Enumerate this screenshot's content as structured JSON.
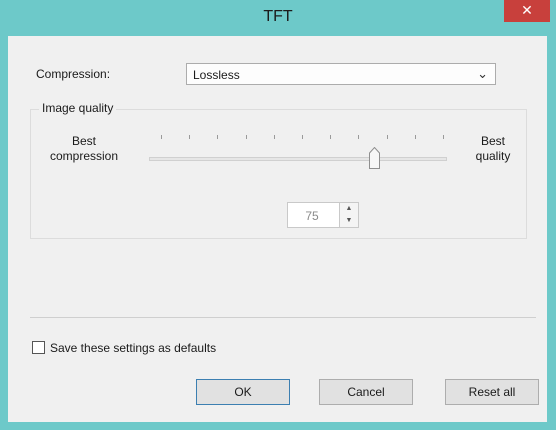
{
  "window": {
    "title": "TFT",
    "close_glyph": "✕"
  },
  "compression": {
    "label": "Compression:",
    "selected": "Lossless"
  },
  "image_quality": {
    "group_label": "Image quality",
    "left_label": "Best\ncompression",
    "right_label": "Best\nquality",
    "slider_value": 75,
    "slider_min": 0,
    "slider_max": 100,
    "spin_value": "75"
  },
  "save_defaults": {
    "label": "Save these settings as defaults",
    "checked": false
  },
  "buttons": {
    "ok": "OK",
    "cancel": "Cancel",
    "reset": "Reset all"
  },
  "colors": {
    "titlebar": "#6dc9c9",
    "close": "#c8403c",
    "client": "#f0f0f0"
  },
  "icons": {
    "close": "close-icon",
    "dropdown": "chevron-down-icon",
    "spin_up": "caret-up-icon",
    "spin_down": "caret-down-icon"
  }
}
